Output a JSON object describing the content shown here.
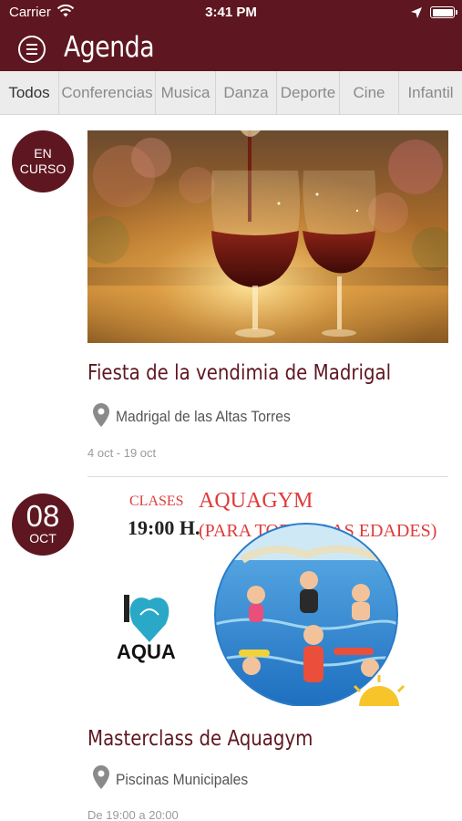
{
  "status_bar": {
    "carrier": "Carrier",
    "time": "3:41 PM"
  },
  "header": {
    "title": "Agenda",
    "menu_icon": "hamburger-menu-icon"
  },
  "tabs": [
    {
      "label": "Todos",
      "active": true
    },
    {
      "label": "Conferencias",
      "active": false
    },
    {
      "label": "Musica",
      "active": false
    },
    {
      "label": "Danza",
      "active": false
    },
    {
      "label": "Deporte",
      "active": false
    },
    {
      "label": "Cine",
      "active": false
    },
    {
      "label": "Infantil",
      "active": false
    }
  ],
  "events": [
    {
      "badge_line1": "EN",
      "badge_line2": "CURSO",
      "title": "Fiesta de la vendimia de Madrigal",
      "place": "Madrigal de las Altas Torres",
      "date": "4 oct - 19 oct",
      "image": "wine-glasses-photo"
    },
    {
      "badge_day": "08",
      "badge_month": "OCT",
      "title": "Masterclass de Aquagym",
      "place": "Piscinas Municipales",
      "date": "De 19:00 a 20:00",
      "image": "aquagym-poster",
      "poster": {
        "line_top_left": "CLASES",
        "heading": "AQUAGYM",
        "time": "19:00 H.",
        "subheading": "(PARA TODAS LAS EDADES)",
        "logo_text": "AQUA"
      }
    }
  ],
  "colors": {
    "brand": "#5e1720",
    "tab_bg": "#ececec",
    "poster_red": "#e03a3a"
  }
}
